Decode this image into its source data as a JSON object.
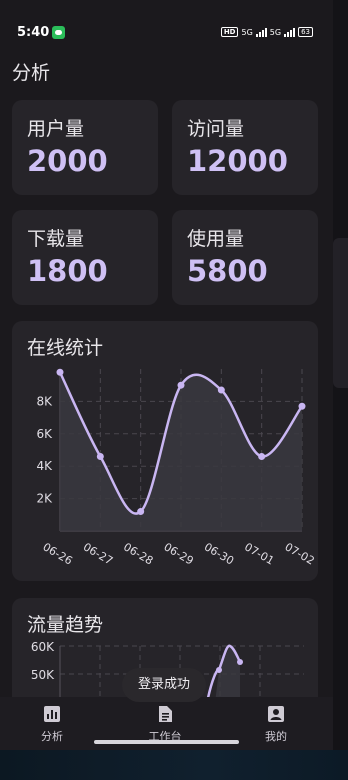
{
  "status_bar": {
    "time": "5:40",
    "hd": "HD",
    "signal1": "5G",
    "signal2": "5G",
    "battery": "63"
  },
  "header": {
    "title": "分析"
  },
  "stats": [
    {
      "label": "用户量",
      "value": "2000"
    },
    {
      "label": "访问量",
      "value": "12000"
    },
    {
      "label": "下载量",
      "value": "1800"
    },
    {
      "label": "使用量",
      "value": "5800"
    }
  ],
  "online_chart": {
    "title": "在线统计"
  },
  "trend_chart": {
    "title": "流量趋势"
  },
  "chart_data": [
    {
      "type": "area",
      "title": "在线统计",
      "categories": [
        "06-26",
        "06-27",
        "06-28",
        "06-29",
        "06-30",
        "07-01",
        "07-02"
      ],
      "series": [
        {
          "values": [
            9800,
            4600,
            1200,
            9000,
            8700,
            4600,
            7700
          ]
        }
      ],
      "yticks": [
        "2K",
        "4K",
        "6K",
        "8K"
      ],
      "ylim": [
        0,
        10000
      ],
      "grid": true
    },
    {
      "type": "area",
      "title": "流量趋势",
      "yticks": [
        "60K",
        "50K"
      ],
      "ylim": [
        0,
        60000
      ],
      "grid": true
    }
  ],
  "toast": {
    "text": "登录成功"
  },
  "tabs": [
    {
      "label": "分析",
      "icon": "analytics-icon"
    },
    {
      "label": "工作台",
      "icon": "document-icon"
    },
    {
      "label": "我的",
      "icon": "profile-icon"
    }
  ],
  "colors": {
    "accent": "#c9b6f2",
    "card": "#262429",
    "background": "#1b191d"
  }
}
